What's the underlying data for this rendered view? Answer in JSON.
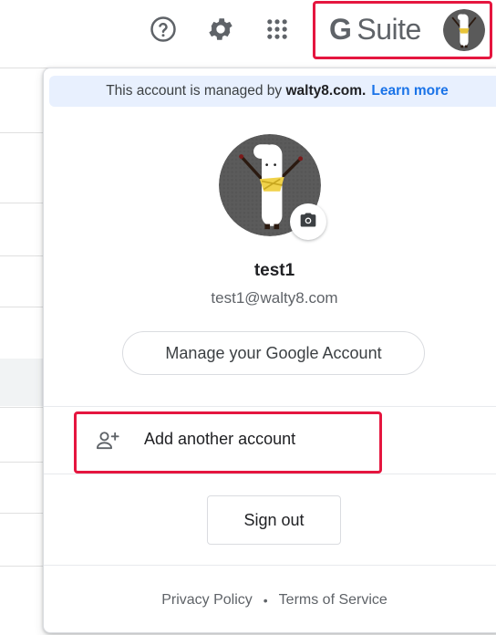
{
  "topbar": {
    "help_icon": "help-circle-icon",
    "settings_icon": "gear-icon",
    "apps_icon": "apps-grid-icon",
    "brand_logo": "G Suite",
    "avatar_icon": "user-avatar"
  },
  "account_panel": {
    "managed_notice_prefix": "This account is managed by",
    "managed_domain": "walty8.com.",
    "learn_more_label": "Learn more",
    "user_name": "test1",
    "user_email": "test1@walty8.com",
    "camera_icon": "camera-icon",
    "manage_account_label": "Manage your Google Account",
    "add_account_icon": "person-add-icon",
    "add_account_label": "Add another account",
    "sign_out_label": "Sign out",
    "footer": {
      "privacy_label": "Privacy Policy",
      "separator": "•",
      "terms_label": "Terms of Service"
    }
  },
  "colors": {
    "highlight_border": "#e5163f",
    "link_blue": "#1a73e8",
    "managed_bg": "#e8f0fe",
    "text_primary": "#202124",
    "text_secondary": "#5f6368"
  }
}
